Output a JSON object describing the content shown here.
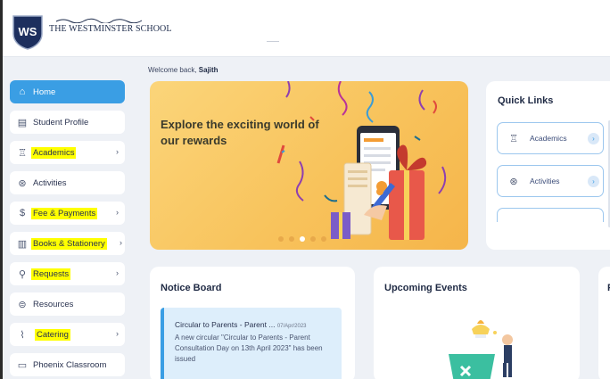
{
  "brand": {
    "logo_monogram": "WS",
    "logo_text": "THE WESTMINSTER SCHOOL"
  },
  "welcome": {
    "prefix": "Welcome back,",
    "name": "Sajith"
  },
  "sidebar": {
    "items": [
      {
        "label": "Home",
        "icon": "home-icon",
        "active": true,
        "highlighted": false,
        "has_chevron": false
      },
      {
        "label": "Student Profile",
        "icon": "profile-icon",
        "active": false,
        "highlighted": false,
        "has_chevron": false
      },
      {
        "label": "Academics",
        "icon": "academics-icon",
        "active": false,
        "highlighted": true,
        "has_chevron": true
      },
      {
        "label": "Activities",
        "icon": "activities-icon",
        "active": false,
        "highlighted": false,
        "has_chevron": false
      },
      {
        "label": "Fee & Payments",
        "icon": "fee-icon",
        "active": false,
        "highlighted": true,
        "has_chevron": true
      },
      {
        "label": "Books & Stationery",
        "icon": "books-icon",
        "active": false,
        "highlighted": true,
        "has_chevron": true
      },
      {
        "label": "Requests",
        "icon": "requests-icon",
        "active": false,
        "highlighted": true,
        "has_chevron": true
      },
      {
        "label": "Resources",
        "icon": "resources-icon",
        "active": false,
        "highlighted": false,
        "has_chevron": false
      },
      {
        "label": "Catering",
        "icon": "catering-icon",
        "active": false,
        "highlighted": true,
        "has_chevron": true
      },
      {
        "label": "Phoenix Classroom",
        "icon": "classroom-icon",
        "active": false,
        "highlighted": false,
        "has_chevron": false
      }
    ]
  },
  "banner": {
    "title": "Explore the exciting world of our rewards",
    "slides_total": 5,
    "slide_active": 3
  },
  "quick_links": {
    "title": "Quick Links",
    "items": [
      {
        "label": "Academics",
        "icon": "academics-icon"
      },
      {
        "label": "Activities",
        "icon": "activities-icon"
      }
    ]
  },
  "notice_board": {
    "title": "Notice Board",
    "item": {
      "heading": "Circular to Parents - Parent ...",
      "date": "07/Apr/2023",
      "body": "A new circular \"Circular to Parents - Parent Consultation Day on 13th April 2023\" has been issued"
    }
  },
  "upcoming_events": {
    "title": "Upcoming Events"
  },
  "third_card": {
    "title": "P"
  },
  "colors": {
    "accent": "#3a9ee4",
    "highlight": "#ffff00",
    "banner": "#f8c35c"
  }
}
